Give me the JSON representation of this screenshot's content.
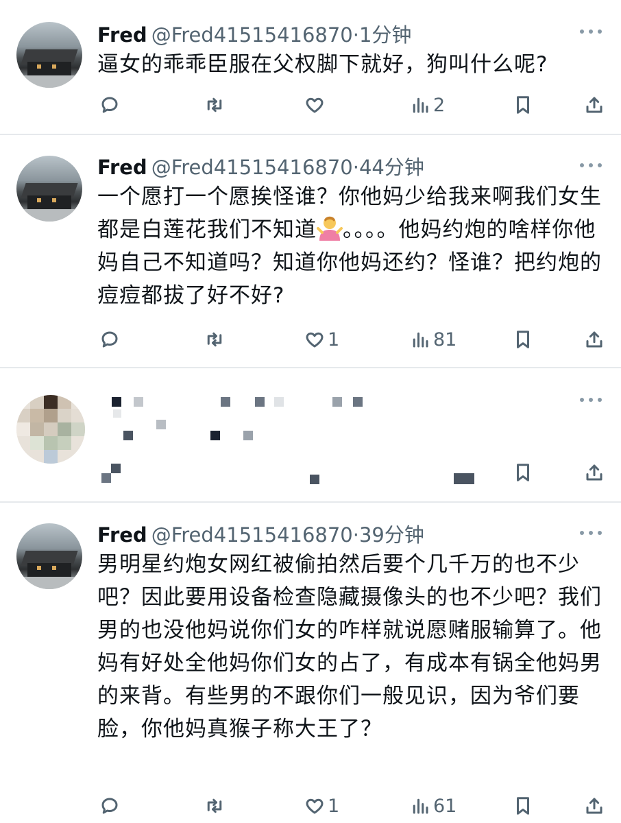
{
  "tweets": [
    {
      "name": "Fred",
      "handle": "@Fred41515416870",
      "time": "·1分钟",
      "text": "逼女的乖乖臣服在父权脚下就好，狗叫什么呢?",
      "views": "2",
      "likes": "",
      "retweets": "",
      "replies": ""
    },
    {
      "name": "Fred",
      "handle": "@Fred41515416870",
      "time": "·44分钟",
      "text_a": "一个愿打一个愿挨怪谁？你他妈少给我来啊我们女生都是白莲花我们不知道",
      "text_b": "。。。。他妈约炮的啥样你他妈自己不知道吗？知道你他妈还约？怪谁？把约炮的痘痘都拔了好不好?",
      "views": "81",
      "likes": "1"
    },
    {
      "name": "Fred",
      "handle": "@Fred41515416870",
      "time": "·39分钟",
      "text": "男明星约炮女网红被偷拍然后要个几千万的也不少吧？因此要用设备检查隐藏摄像头的也不少吧？我们男的也没他妈说你们女的咋样就说愿赌服输算了。他妈有好处全他妈你们女的占了，有成本有锅全他妈男的来背。有些男的不跟你们一般见识，因为爷们要脸，你他妈真猴子称大王了？",
      "views": "61",
      "likes": "1"
    }
  ],
  "icons": {
    "reply": "reply-icon",
    "retweet": "retweet-icon",
    "like": "heart-icon",
    "views": "views-icon",
    "bookmark": "bookmark-icon",
    "share": "share-icon",
    "more": "more-icon"
  },
  "colors": {
    "text": "#0f1419",
    "secondary": "#536471",
    "divider": "#e6e9ec"
  }
}
